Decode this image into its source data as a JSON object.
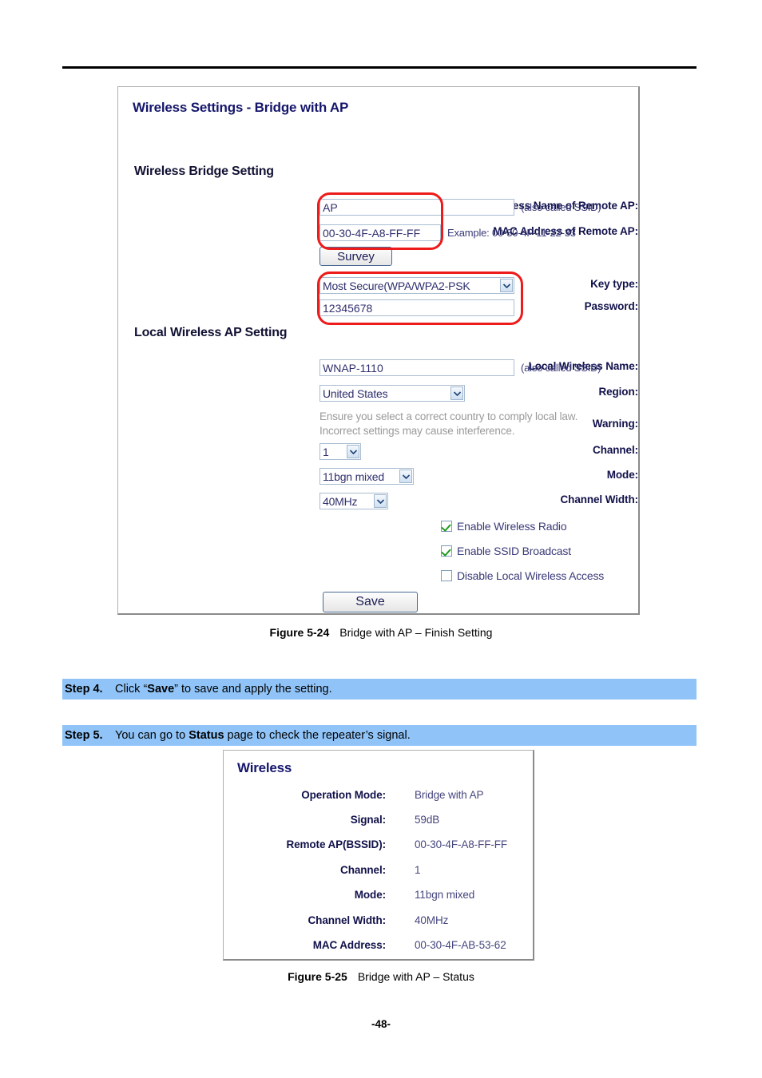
{
  "document": {
    "page_number": "-48-"
  },
  "figure1": {
    "panel_title": "Wireless Settings - Bridge with AP",
    "sections": {
      "bridge": "Wireless Bridge Setting",
      "local_ap": "Local Wireless AP Setting"
    },
    "fields": {
      "remote_ssid": {
        "label": "Wireless Name of Remote AP:",
        "value": "AP",
        "hint": "(also called SSID)"
      },
      "remote_mac": {
        "label": "MAC Address of Remote AP:",
        "value": "00-30-4F-A8-FF-FF",
        "hint": "Example: 00-30-4F-11-22-33"
      },
      "survey_button": "Survey",
      "key_type": {
        "label": "Key type:",
        "value": "Most Secure(WPA/WPA2-PSK"
      },
      "password": {
        "label": "Password:",
        "value": "12345678"
      },
      "local_ssid": {
        "label": "Local Wireless Name:",
        "value": "WNAP-1110",
        "hint": "(also called SSID)"
      },
      "region": {
        "label": "Region:",
        "value": "United States"
      },
      "warning": {
        "label": "Warning:",
        "line1": "Ensure you select a correct country to comply local law.",
        "line2": "Incorrect settings may cause interference."
      },
      "channel": {
        "label": "Channel:",
        "value": "1"
      },
      "mode": {
        "label": "Mode:",
        "value": "11bgn mixed"
      },
      "channel_width": {
        "label": "Channel Width:",
        "value": "40MHz"
      }
    },
    "checkboxes": [
      {
        "label": "Enable Wireless Radio",
        "checked": true
      },
      {
        "label": "Enable SSID Broadcast",
        "checked": true
      },
      {
        "label": "Disable Local Wireless Access",
        "checked": false
      }
    ],
    "save_button": "Save",
    "caption": {
      "number": "Figure 5-24",
      "text": "Bridge with AP – Finish Setting"
    },
    "highlight_color": "#ee1b1b"
  },
  "steps": [
    {
      "number": "Step 4.",
      "text_before": "Click “",
      "bold": "Save",
      "text_after": "” to save and apply the setting."
    },
    {
      "number": "Step 5.",
      "text_before": "You can go to ",
      "bold": "Status",
      "text_after": " page to check the repeater’s signal."
    }
  ],
  "figure2": {
    "panel_title": "Wireless",
    "rows": [
      {
        "label": "Operation Mode:",
        "value": "Bridge with AP"
      },
      {
        "label": "Signal:",
        "value": "59dB"
      },
      {
        "label": "Remote AP(BSSID):",
        "value": "00-30-4F-A8-FF-FF"
      },
      {
        "label": "Channel:",
        "value": "1"
      },
      {
        "label": "Mode:",
        "value": "11bgn mixed"
      },
      {
        "label": "Channel Width:",
        "value": "40MHz"
      },
      {
        "label": "MAC Address:",
        "value": "00-30-4F-AB-53-62"
      }
    ],
    "caption": {
      "number": "Figure 5-25",
      "text": "Bridge with AP – Status"
    }
  }
}
